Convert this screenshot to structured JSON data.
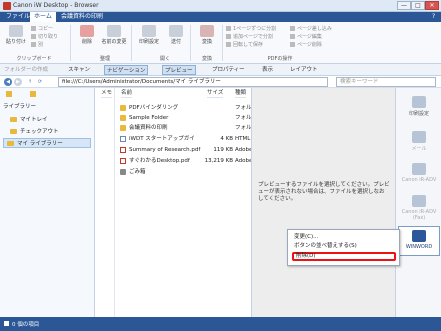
{
  "window": {
    "title": "Canon iW Desktop - Browser",
    "controls": [
      "—",
      "□",
      "✕"
    ]
  },
  "menubar": {
    "tabs": [
      "ファイル",
      "ホーム",
      "会議資料の印刷"
    ],
    "active_index": 1,
    "help": "?"
  },
  "ribbon": {
    "paste": "貼り付け",
    "copy": "コピー",
    "cut": "切り取り",
    "shortcut": "別",
    "delete": "削除",
    "rename": "名前の変更",
    "print_settings": "印刷設定",
    "send": "送付",
    "convert": "変換",
    "split_pages": "1ページずつに分割",
    "merge_docs": "結合",
    "add_page_after": "追加ページで分割",
    "rotate": "回転して保存",
    "insert_page": "ページ差し込み",
    "edit_page": "ページ編集",
    "delete_page": "ページ削除",
    "groups": [
      "クリップボード",
      "整理",
      "開く",
      "変換",
      "PDFの操作"
    ]
  },
  "toolbar": {
    "folder_ops": "フォルダーの作成",
    "scan": "スキャン",
    "navigation": "ナビゲーション",
    "preview": "プレビュー",
    "properties": "プロパティー",
    "view": "表示",
    "layout": "レイアウト"
  },
  "address": {
    "path": "file:///C:/Users/Administrator/Documents/マイ ライブラリー",
    "search_placeholder": "検索キーワード"
  },
  "left_pane": {
    "header": "ライブラリー",
    "items": [
      "マイトレイ",
      "チェックアウト",
      "マイ ライブラリー"
    ],
    "selected_index": 2
  },
  "file_list": {
    "columns": [
      "メモ",
      "名前",
      "サイズ",
      "種類"
    ],
    "rows": [
      {
        "name": "PDFバインダリング",
        "size": "",
        "type": "フォル",
        "kind": "folder"
      },
      {
        "name": "Sample Folder",
        "size": "",
        "type": "フォル",
        "kind": "folder"
      },
      {
        "name": "会議資料の印刷",
        "size": "",
        "type": "フォル",
        "kind": "folder"
      },
      {
        "name": "iWDT スタートアップガイ",
        "size": "4 KB",
        "type": "HTML",
        "kind": "html"
      },
      {
        "name": "Summary of Research.pdf",
        "size": "119 KB",
        "type": "Adobe",
        "kind": "pdf"
      },
      {
        "name": "すぐわかるDesktop.pdf",
        "size": "13,219 KB",
        "type": "Adobe",
        "kind": "pdf"
      },
      {
        "name": "ごみ箱",
        "size": "",
        "type": "",
        "kind": "bin"
      }
    ]
  },
  "preview": {
    "message": "プレビューするファイルを選択してください。プレビューが表示されない場合は、ファイルを選択しなおしてください。"
  },
  "right_bar": {
    "buttons": [
      "印刷設定",
      "メール",
      "Canon iR-ADV",
      "Canon iR-ADV (Fax)",
      "WINWORD"
    ]
  },
  "context_menu": {
    "items": [
      "変更(C)...",
      "ボタンの並べ替えする(S)",
      "削除(D)"
    ],
    "highlighted_index": 2
  },
  "status": {
    "text": "0 個の項目"
  },
  "colors": {
    "accent": "#2b5797",
    "highlight_border": "#e11111"
  }
}
